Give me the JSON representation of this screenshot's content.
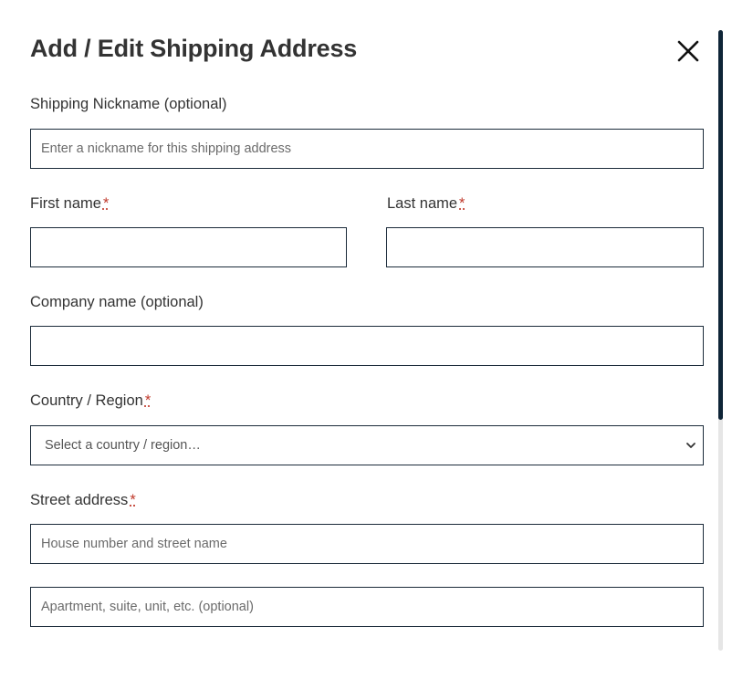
{
  "dialog": {
    "title": "Add / Edit Shipping Address",
    "close_icon": "close-icon"
  },
  "form": {
    "nickname": {
      "label": "Shipping Nickname (optional)",
      "placeholder": "Enter a nickname for this shipping address",
      "value": ""
    },
    "first_name": {
      "label": "First name",
      "required_mark": "*",
      "value": ""
    },
    "last_name": {
      "label": "Last name",
      "required_mark": "*",
      "value": ""
    },
    "company": {
      "label": "Company name (optional)",
      "value": ""
    },
    "country": {
      "label": "Country / Region",
      "required_mark": "*",
      "selected": "Select a country / region…",
      "icon": "chevron-down-icon"
    },
    "street": {
      "label": "Street address",
      "required_mark": "*",
      "placeholder_line1": "House number and street name",
      "placeholder_line2": "Apartment, suite, unit, etc. (optional)"
    }
  },
  "colors": {
    "border": "#1b2b3a",
    "required": "#c0392b",
    "scrollbar_thumb": "#0f2537",
    "text": "#333333"
  }
}
